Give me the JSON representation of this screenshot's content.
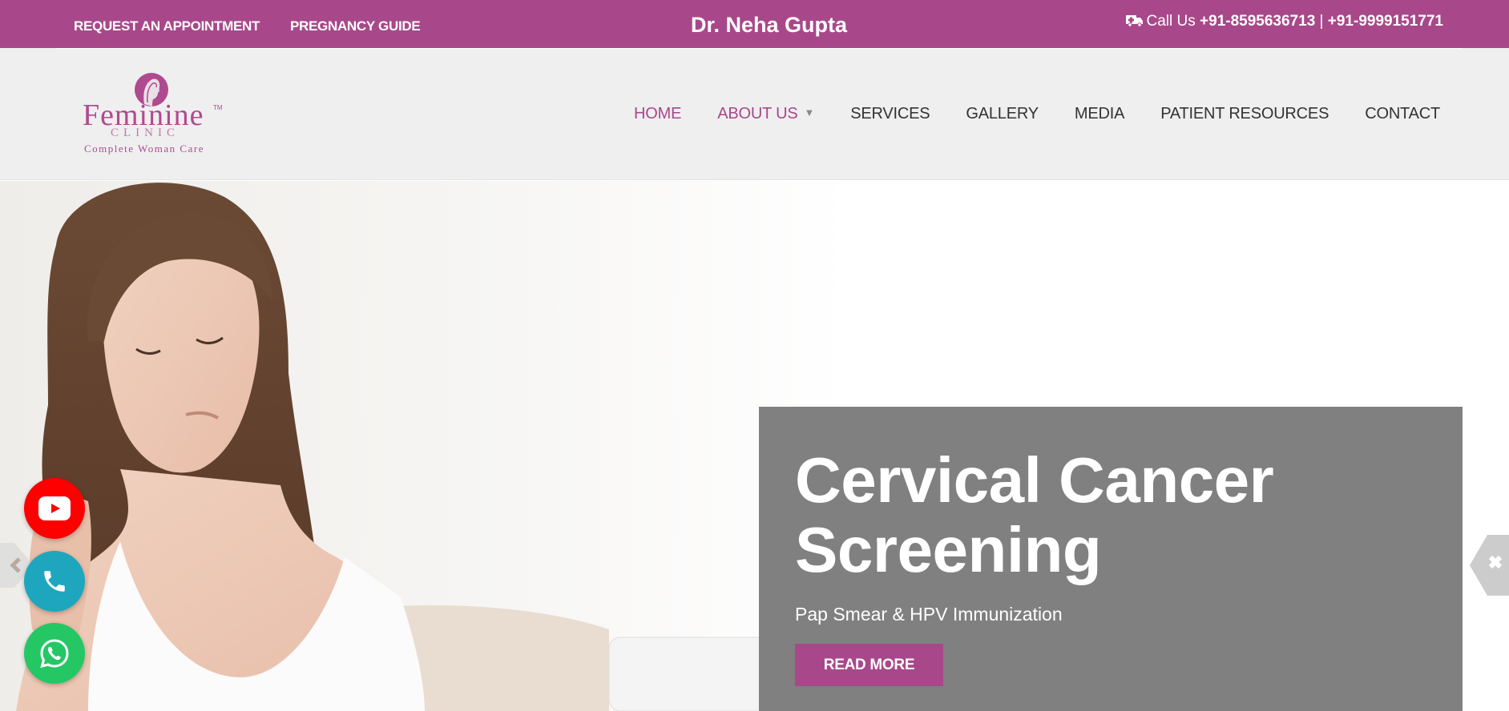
{
  "topbar": {
    "request_label": "REQUEST AN APPOINTMENT",
    "guide_label": "PREGNANCY GUIDE",
    "brand": "Dr. Neha Gupta",
    "call_prefix": "Call Us",
    "phone1": "+91-8595636713",
    "separator": "|",
    "phone2": "+91-9999151771",
    "icon": "ambulance-icon"
  },
  "logo": {
    "name": "Feminine",
    "tm": "TM",
    "clinic": "CLINIC",
    "tagline": "Complete Woman Care"
  },
  "nav": {
    "items": [
      {
        "label": "HOME",
        "active": true
      },
      {
        "label": "ABOUT US",
        "active": true,
        "has_dropdown": true
      },
      {
        "label": "SERVICES"
      },
      {
        "label": "GALLERY"
      },
      {
        "label": "MEDIA"
      },
      {
        "label": "PATIENT RESOURCES"
      },
      {
        "label": "CONTACT"
      }
    ],
    "caret": "▼"
  },
  "hero": {
    "title": "Cervical Cancer Screening",
    "subtitle": "Pap Smear & HPV Immunization",
    "button_label": "READ MORE"
  },
  "social": {
    "youtube_icon": "youtube-icon",
    "phone_icon": "phone-icon",
    "whatsapp_icon": "whatsapp-icon"
  },
  "colors": {
    "brand": "#a8488a",
    "caption_bg": "#808080",
    "youtube": "#ff0000",
    "phone": "#1fa6bf",
    "whatsapp": "#25c765"
  }
}
